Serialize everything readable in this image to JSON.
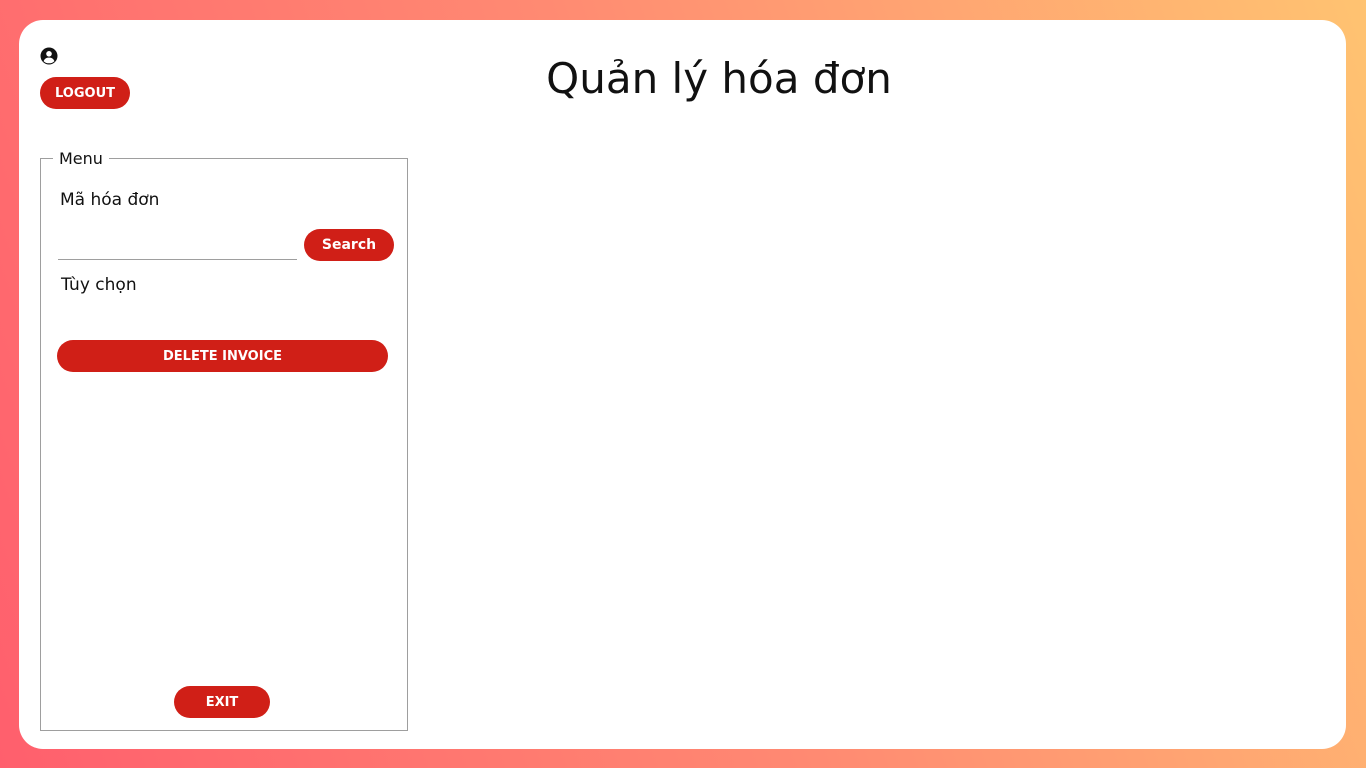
{
  "header": {
    "user_icon": "user-circle-icon",
    "logout_label": "LOGOUT",
    "title": "Quản lý hóa đơn"
  },
  "menu": {
    "legend": "Menu",
    "code_label": "Mã hóa đơn",
    "search_value": "",
    "search_label": "Search",
    "option_label": "Tùy chọn",
    "delete_label": "DELETE INVOICE",
    "exit_label": "EXIT"
  },
  "colors": {
    "accent": "#d01f17",
    "background_gradient": [
      "#ff5f6d",
      "#ffc371"
    ]
  }
}
